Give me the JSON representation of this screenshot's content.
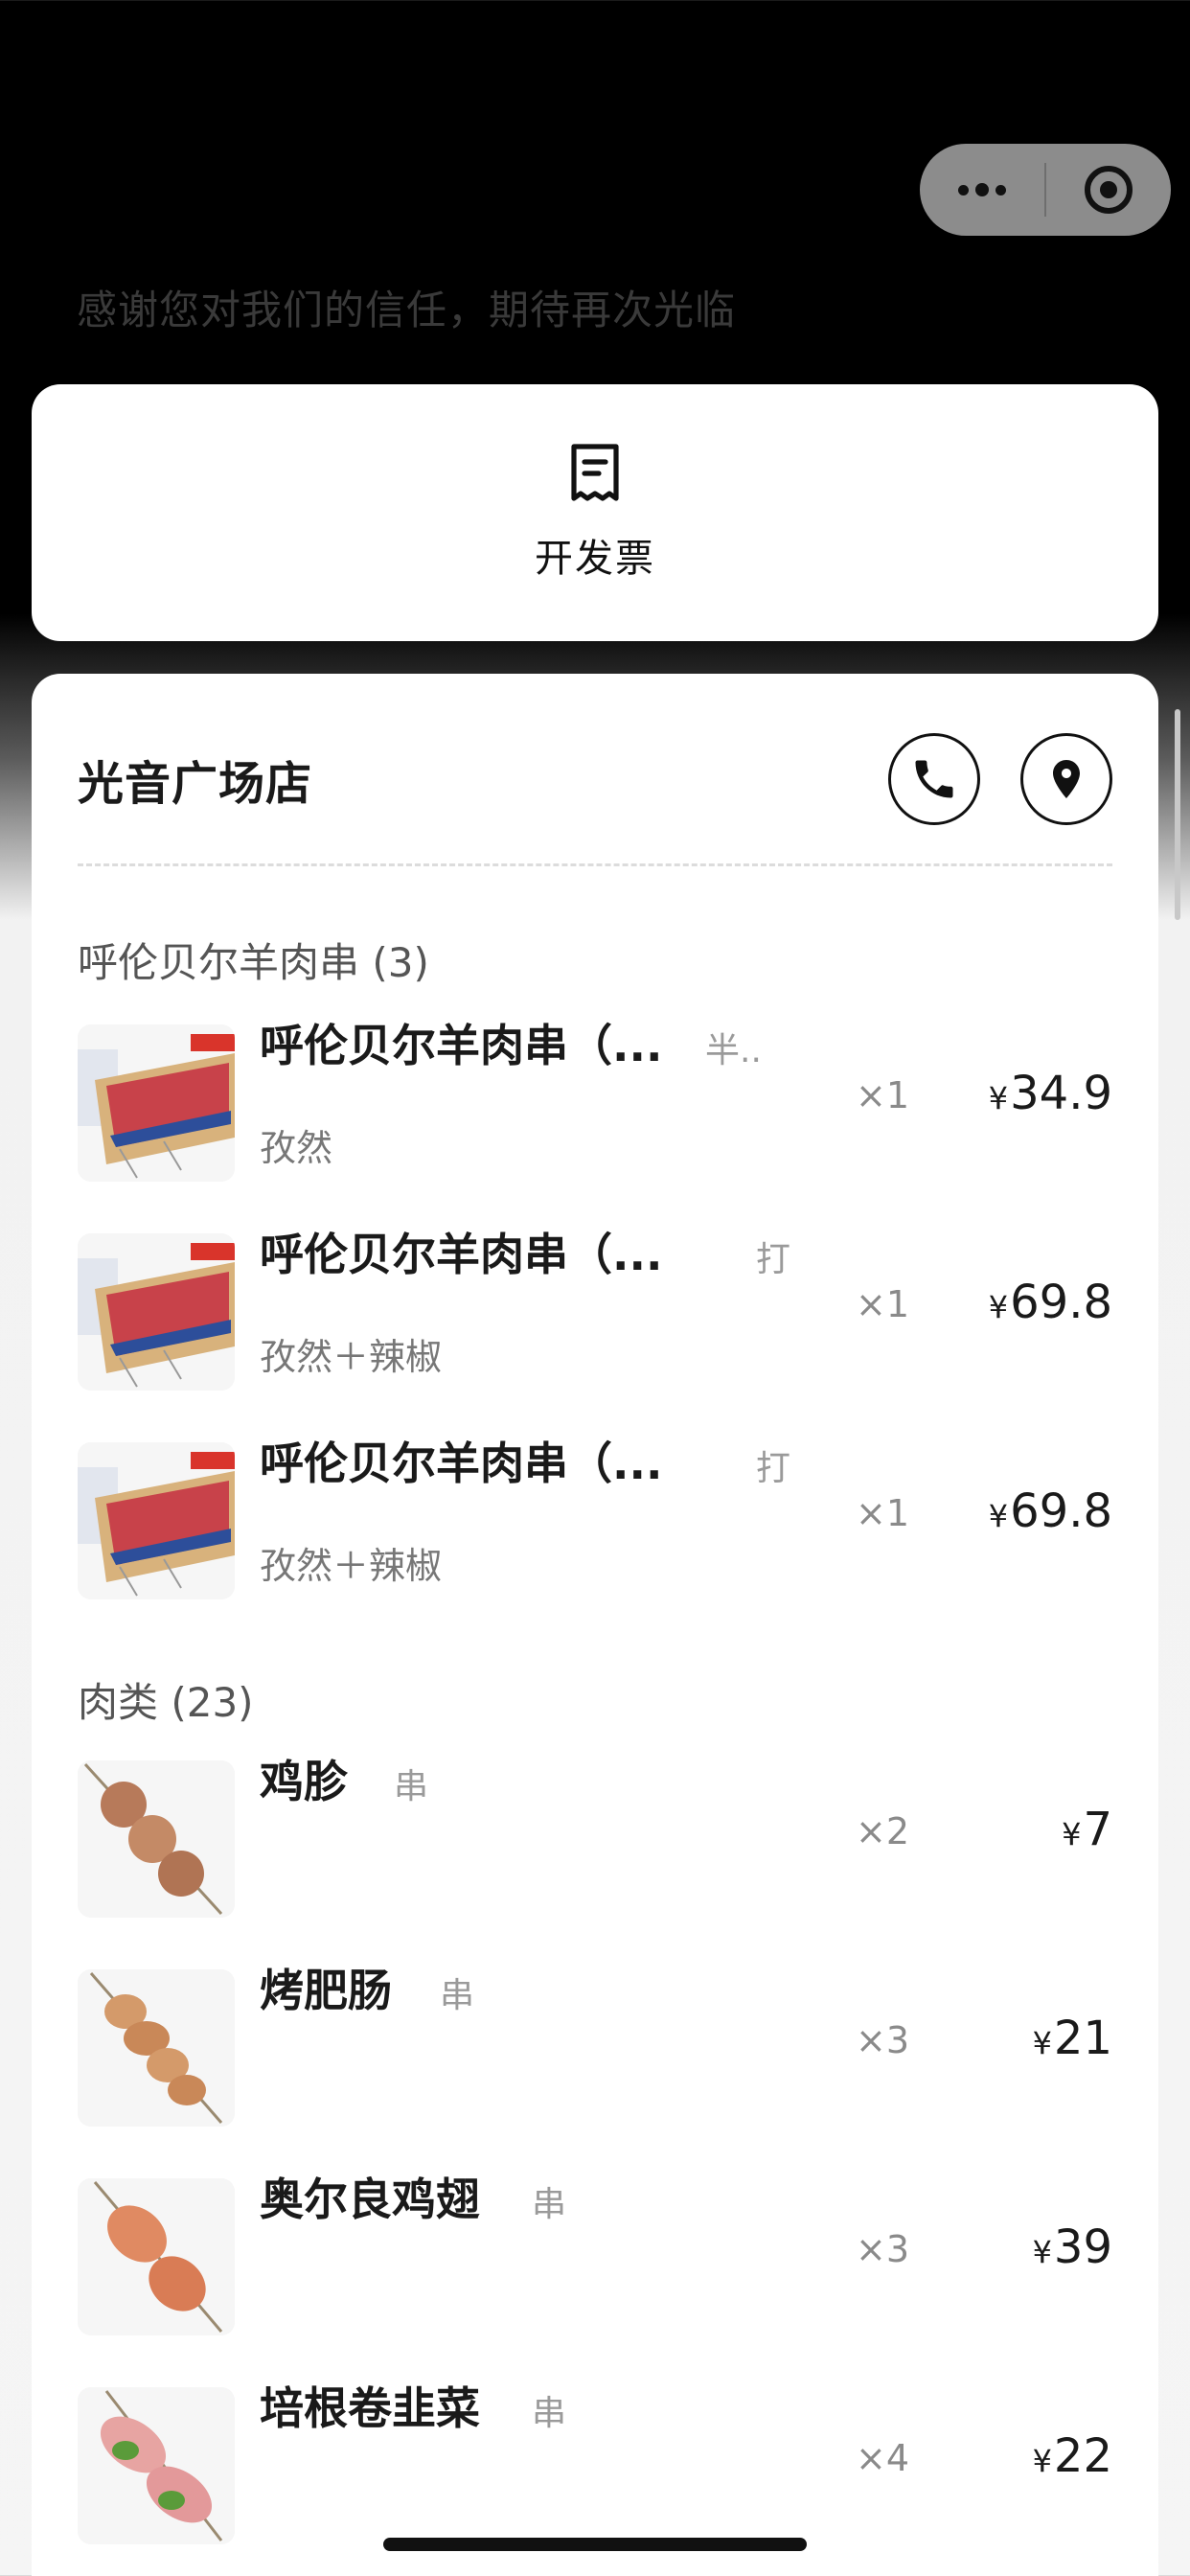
{
  "header": {
    "thanks_text": "感谢您对我们的信任，期待再次光临",
    "capsule": {
      "more_icon": "more-dots-icon",
      "close_icon": "target-close-icon"
    }
  },
  "invoice": {
    "label": "开发票",
    "icon": "receipt-icon"
  },
  "store": {
    "name": "光音广场店",
    "phone_icon": "phone-icon",
    "location_icon": "location-pin-icon"
  },
  "sections": [
    {
      "title": "呼伦贝尔羊肉串 (3)",
      "items": [
        {
          "name": "呼伦贝尔羊肉串（...",
          "tag": "半..",
          "sub": "孜然",
          "qty": "×1",
          "currency": "¥",
          "price": "34.9"
        },
        {
          "name": "呼伦贝尔羊肉串（...",
          "tag": "打",
          "sub": "孜然＋辣椒",
          "qty": "×1",
          "currency": "¥",
          "price": "69.8"
        },
        {
          "name": "呼伦贝尔羊肉串（...",
          "tag": "打",
          "sub": "孜然＋辣椒",
          "qty": "×1",
          "currency": "¥",
          "price": "69.8"
        }
      ]
    },
    {
      "title": "肉类 (23)",
      "items": [
        {
          "name": "鸡胗",
          "tag": "串",
          "sub": "",
          "qty": "×2",
          "currency": "¥",
          "price": "7"
        },
        {
          "name": "烤肥肠",
          "tag": "串",
          "sub": "",
          "qty": "×3",
          "currency": "¥",
          "price": "21"
        },
        {
          "name": "奥尔良鸡翅",
          "tag": "串",
          "sub": "",
          "qty": "×3",
          "currency": "¥",
          "price": "39"
        },
        {
          "name": "培根卷韭菜",
          "tag": "串",
          "sub": "",
          "qty": "×4",
          "currency": "¥",
          "price": "22"
        }
      ]
    }
  ]
}
